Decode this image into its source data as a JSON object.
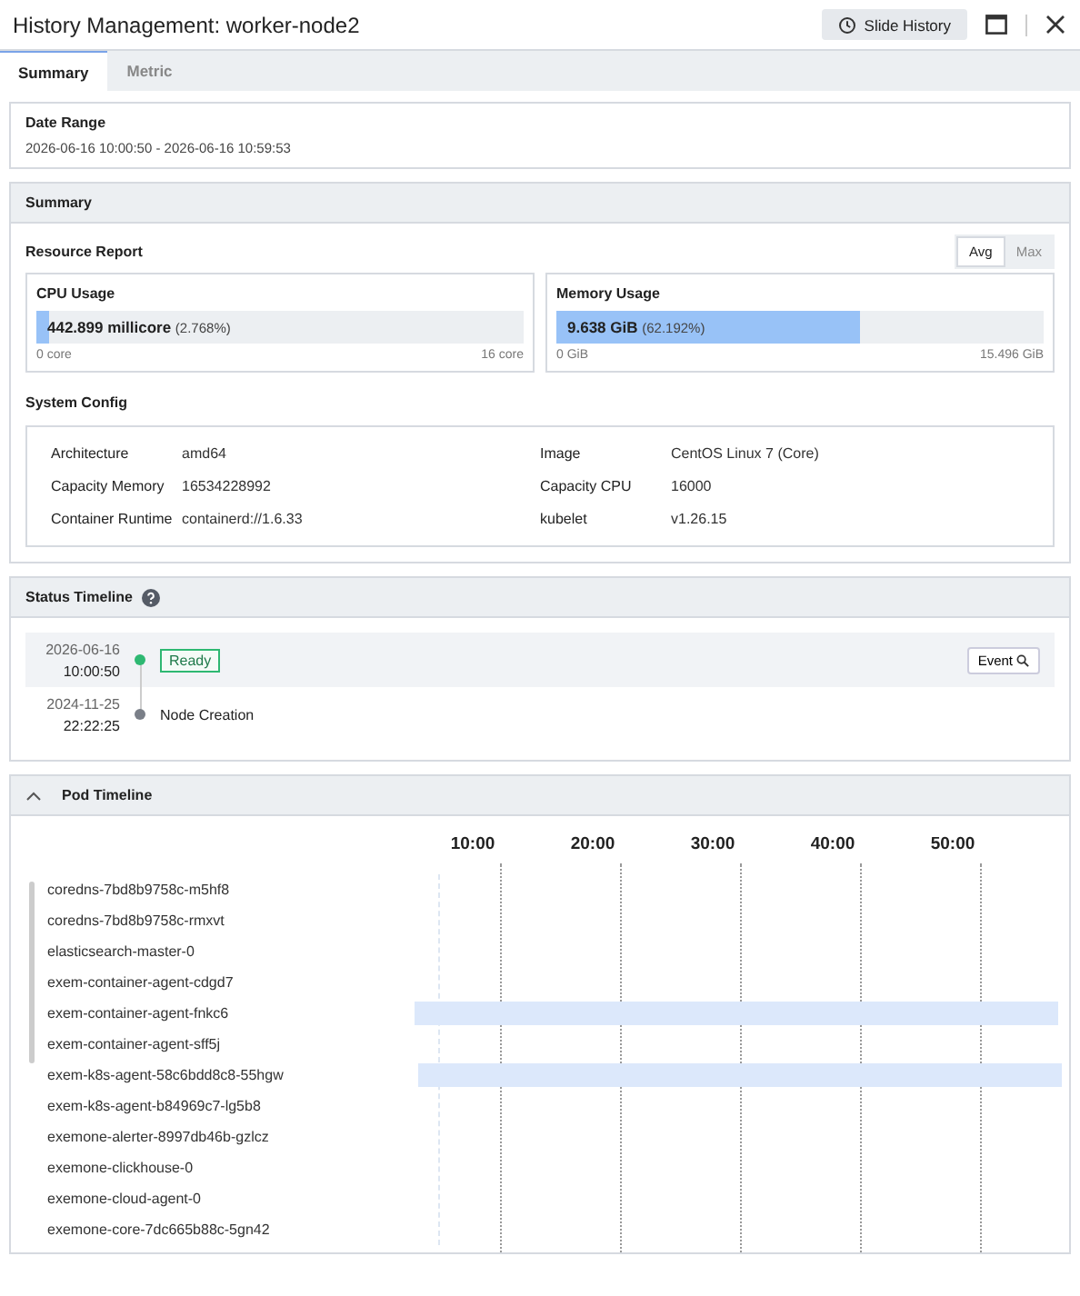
{
  "window": {
    "title": "History Management: worker-node2",
    "slide_history_button": "Slide History"
  },
  "tabs": [
    {
      "label": "Summary",
      "selected": true
    },
    {
      "label": "Metric",
      "selected": false
    }
  ],
  "date_range": {
    "title": "Date Range",
    "value": "2026-06-16 10:00:50 - 2026-06-16 10:59:53"
  },
  "summary": {
    "title": "Summary",
    "resource_report": {
      "title": "Resource Report",
      "modes": [
        {
          "label": "Avg",
          "selected": true
        },
        {
          "label": "Max",
          "selected": false
        }
      ],
      "gauges": [
        {
          "title": "CPU Usage",
          "value": "442.899 millicore",
          "percent": "(2.768%)",
          "level": 0.02768,
          "min": "0 core",
          "max": "16 core"
        },
        {
          "title": "Memory Usage",
          "value": "9.638 GiB",
          "percent": "(62.192%)",
          "level": 0.62192,
          "min": "0 GiB",
          "max": "15.496 GiB"
        }
      ]
    },
    "system_config": {
      "title": "System Config",
      "items": [
        {
          "label": "Architecture",
          "value": "amd64"
        },
        {
          "label": "Image",
          "value": "CentOS Linux 7 (Core)"
        },
        {
          "label": "Capacity Memory",
          "value": "16534228992"
        },
        {
          "label": "Capacity CPU",
          "value": "16000"
        },
        {
          "label": "Container Runtime",
          "value": "containerd://1.6.33"
        },
        {
          "label": "kubelet",
          "value": "v1.26.15"
        }
      ]
    }
  },
  "status_timeline": {
    "title": "Status Timeline",
    "events": [
      {
        "date": "2026-06-16",
        "time": "10:00:50",
        "kind": "status",
        "label": "Ready",
        "selected": true,
        "color": "#2eb872",
        "button": "Event"
      },
      {
        "date": "2024-11-25",
        "time": "22:22:25",
        "kind": "text",
        "label": "Node Creation",
        "selected": false,
        "color": "#7a7f88"
      }
    ]
  },
  "pod_timeline": {
    "title": "Pod Timeline",
    "expanded": true,
    "ticks": [
      "10:00",
      "20:00",
      "30:00",
      "40:00",
      "50:00"
    ],
    "pods": [
      {
        "name": "coredns-7bd8b9758c-m5hf8",
        "active": false
      },
      {
        "name": "coredns-7bd8b9758c-rmxvt",
        "active": false
      },
      {
        "name": "elasticsearch-master-0",
        "active": false
      },
      {
        "name": "exem-container-agent-cdgd7",
        "active": false
      },
      {
        "name": "exem-container-agent-fnkc6",
        "active": true
      },
      {
        "name": "exem-container-agent-sff5j",
        "active": false
      },
      {
        "name": "exem-k8s-agent-58c6bdd8c8-55hgw",
        "active": true
      },
      {
        "name": "exem-k8s-agent-b84969c7-lg5b8",
        "active": false
      },
      {
        "name": "exemone-alerter-8997db46b-gzlcz",
        "active": false
      },
      {
        "name": "exemone-clickhouse-0",
        "active": false
      },
      {
        "name": "exemone-cloud-agent-0",
        "active": false
      },
      {
        "name": "exemone-core-7dc665b88c-5gn42",
        "active": false
      }
    ]
  }
}
